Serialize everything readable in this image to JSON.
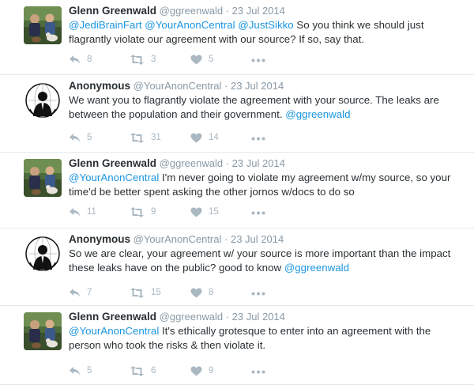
{
  "tweets": [
    {
      "name": "Glenn Greenwald",
      "handle": "@ggreenwald",
      "dot": "·",
      "time": "23 Jul 2014",
      "avatar": "greenwald-photo",
      "text": [
        {
          "t": "@JediBrainFart",
          "m": true
        },
        {
          "t": " ",
          "m": false
        },
        {
          "t": "@YourAnonCentral",
          "m": true
        },
        {
          "t": " ",
          "m": false
        },
        {
          "t": "@JustSikko",
          "m": true
        },
        {
          "t": " So you think we should just flagrantly violate our agreement with our source? If so, say that.",
          "m": false
        }
      ],
      "replies": "8",
      "retweets": "3",
      "likes": "5"
    },
    {
      "name": "Anonymous",
      "handle": "@YourAnonCentral",
      "dot": "·",
      "time": "23 Jul 2014",
      "avatar": "anonymous-logo",
      "text": [
        {
          "t": "We want you to flagrantly violate the agreement with your source. The leaks are between the population and their government. ",
          "m": false
        },
        {
          "t": "@ggreenwald",
          "m": true
        }
      ],
      "replies": "5",
      "retweets": "31",
      "likes": "14"
    },
    {
      "name": "Glenn Greenwald",
      "handle": "@ggreenwald",
      "dot": "·",
      "time": "23 Jul 2014",
      "avatar": "greenwald-photo",
      "text": [
        {
          "t": "@YourAnonCentral",
          "m": true
        },
        {
          "t": " I'm never going to violate my agreement w/my source, so your time'd be better spent asking the other jornos w/docs to do so",
          "m": false
        }
      ],
      "replies": "11",
      "retweets": "9",
      "likes": "15"
    },
    {
      "name": "Anonymous",
      "handle": "@YourAnonCentral",
      "dot": "·",
      "time": "23 Jul 2014",
      "avatar": "anonymous-logo",
      "text": [
        {
          "t": "So we are clear, your agreement w/ your source is more important than the impact these leaks have on the public? good to know ",
          "m": false
        },
        {
          "t": "@ggreenwald",
          "m": true
        }
      ],
      "replies": "7",
      "retweets": "15",
      "likes": "8"
    },
    {
      "name": "Glenn Greenwald",
      "handle": "@ggreenwald",
      "dot": "·",
      "time": "23 Jul 2014",
      "avatar": "greenwald-photo",
      "text": [
        {
          "t": "@YourAnonCentral",
          "m": true
        },
        {
          "t": " It's ethically grotesque to enter into an agreement with the person who took the risks & then violate it.",
          "m": false
        }
      ],
      "replies": "5",
      "retweets": "6",
      "likes": "9"
    }
  ],
  "icons": {
    "reply": "reply-icon",
    "retweet": "retweet-icon",
    "like": "heart-icon",
    "more": "more-dots-icon"
  },
  "colors": {
    "mention": "#1b95e0",
    "meta": "#8899a6",
    "action": "#aab8c2",
    "divider": "#e1e8ed"
  }
}
